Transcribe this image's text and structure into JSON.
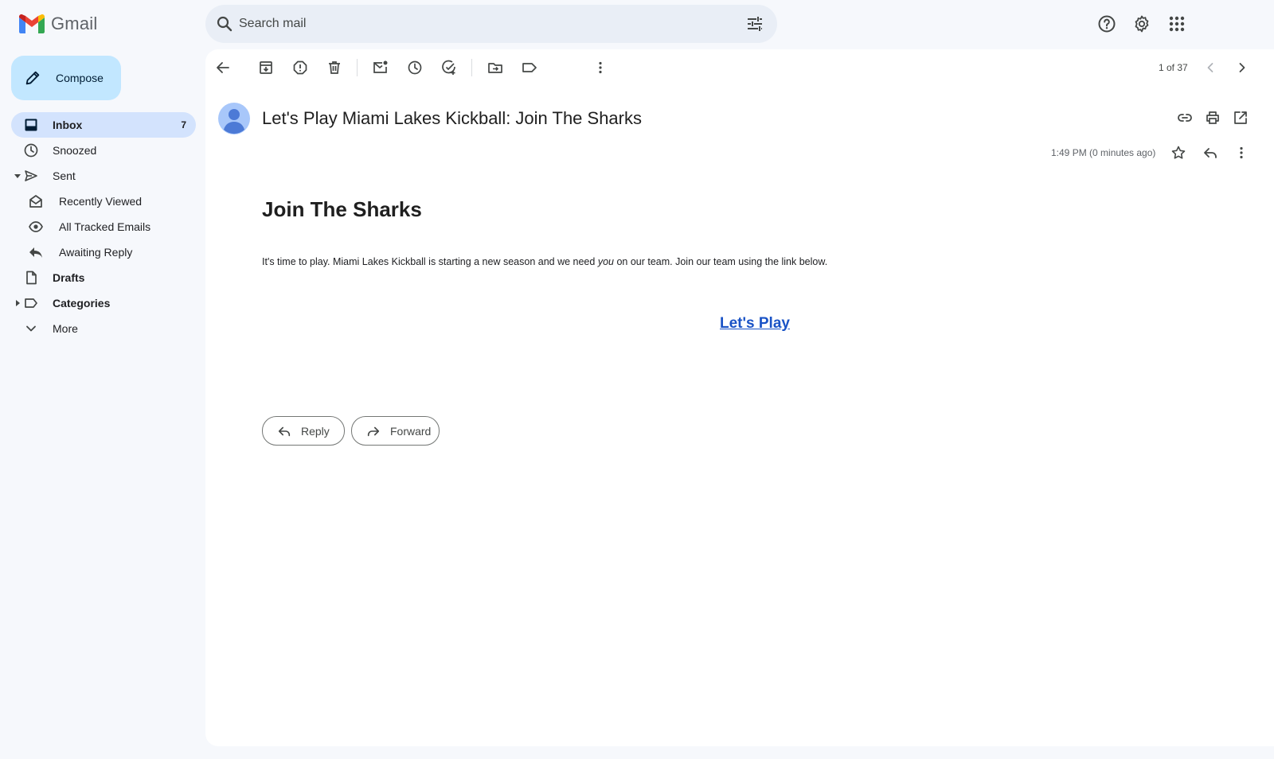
{
  "app": {
    "name": "Gmail"
  },
  "search": {
    "placeholder": "Search mail"
  },
  "compose": {
    "label": "Compose"
  },
  "sidebar": {
    "items": [
      {
        "label": "Inbox",
        "count": "7",
        "icon": "inbox-icon"
      },
      {
        "label": "Snoozed",
        "icon": "clock-icon"
      },
      {
        "label": "Sent",
        "icon": "send-icon"
      },
      {
        "label": "Recently Viewed",
        "icon": "open-envelope-icon"
      },
      {
        "label": "All Tracked Emails",
        "icon": "eye-icon"
      },
      {
        "label": "Awaiting Reply",
        "icon": "reply-icon"
      },
      {
        "label": "Drafts",
        "icon": "draft-icon"
      },
      {
        "label": "Categories",
        "icon": "label-icon"
      },
      {
        "label": "More",
        "icon": "chevron-down-icon"
      }
    ]
  },
  "toolbar": {
    "pager": "1 of 37"
  },
  "message": {
    "subject": "Let's Play Miami Lakes Kickball: Join The Sharks",
    "time": "1:49 PM (0 minutes ago)",
    "heading": "Join The Sharks",
    "body_before": "It's time to play. Miami Lakes Kickball is starting a new season and we need ",
    "body_emphasis": "you",
    "body_after": " on our team. Join our team using the link below.",
    "cta_label": "Let's Play"
  },
  "actions": {
    "reply_label": "Reply",
    "forward_label": "Forward"
  },
  "colors": {
    "accent": "#c2e7ff",
    "active_nav": "#d3e3fd",
    "link": "#1a53c6",
    "background": "#f6f8fc"
  }
}
